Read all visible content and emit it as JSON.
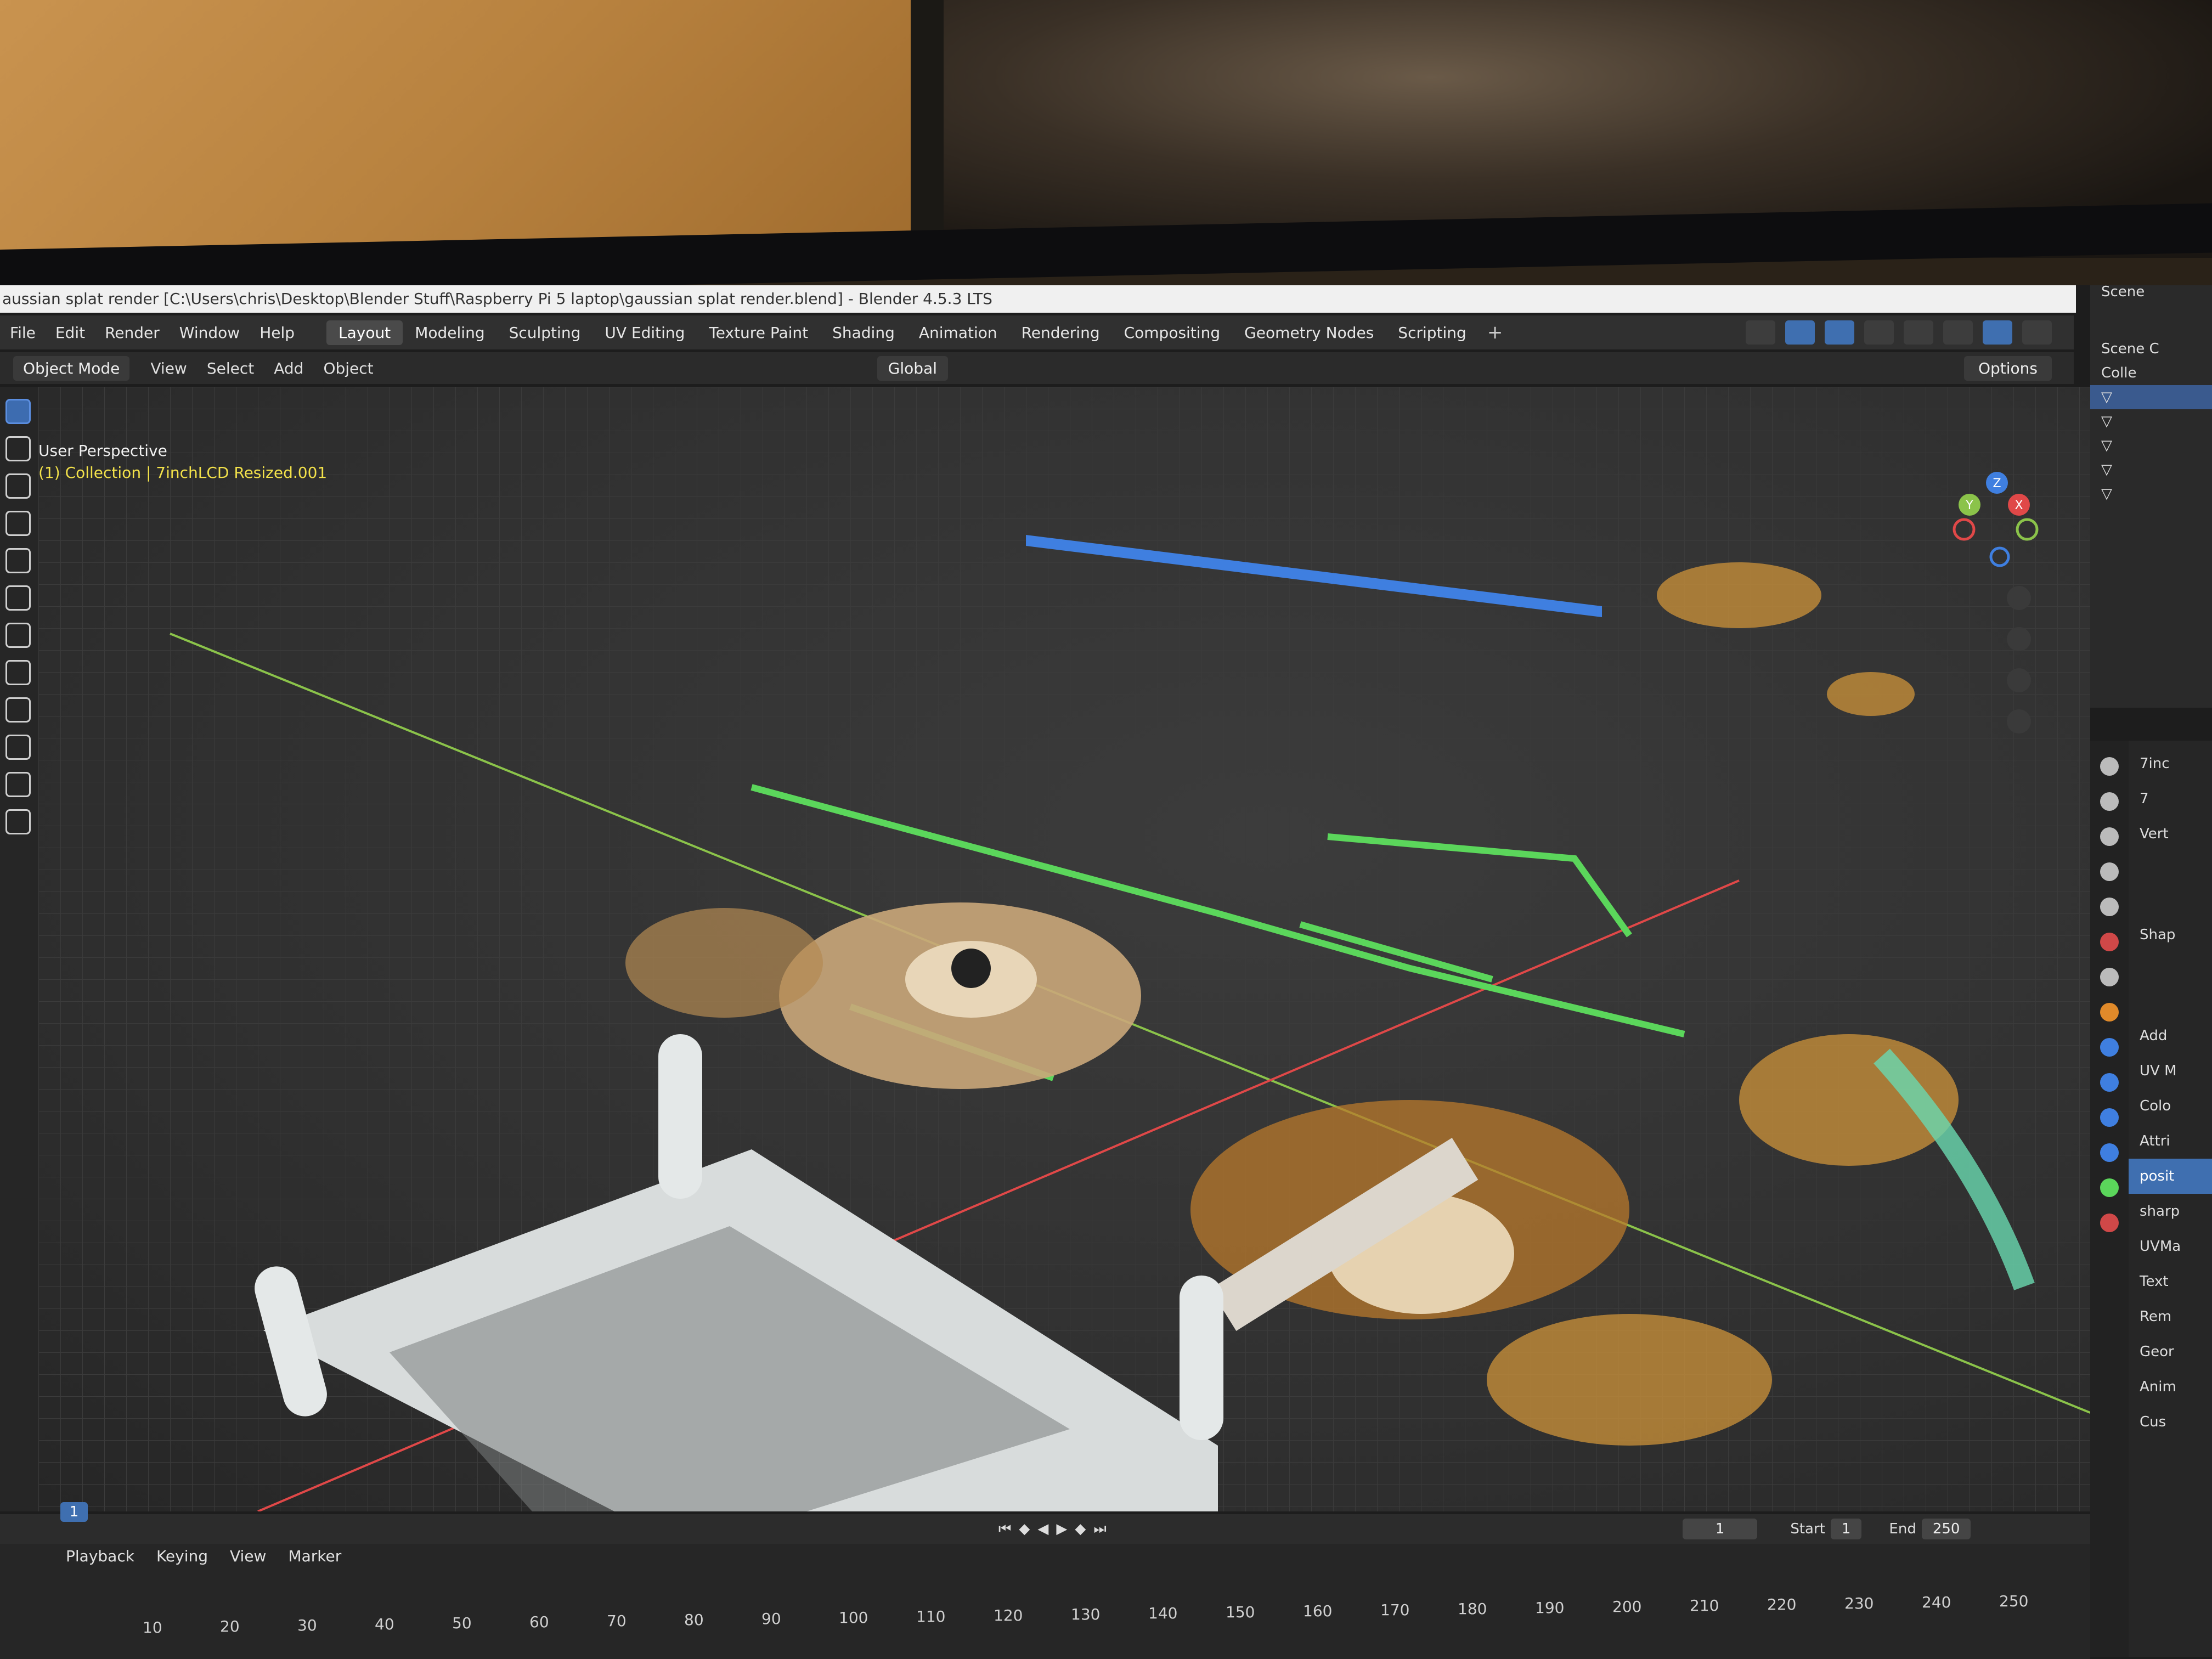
{
  "window": {
    "title": "aussian splat render [C:\\Users\\chris\\Desktop\\Blender Stuff\\Raspberry Pi 5 laptop\\gaussian splat render.blend] - Blender 4.5.3 LTS"
  },
  "menu": [
    "File",
    "Edit",
    "Render",
    "Window",
    "Help"
  ],
  "workspaces": [
    {
      "label": "Layout",
      "active": true
    },
    {
      "label": "Modeling"
    },
    {
      "label": "Sculpting"
    },
    {
      "label": "UV Editing"
    },
    {
      "label": "Texture Paint"
    },
    {
      "label": "Shading"
    },
    {
      "label": "Animation"
    },
    {
      "label": "Rendering"
    },
    {
      "label": "Compositing"
    },
    {
      "label": "Geometry Nodes"
    },
    {
      "label": "Scripting"
    }
  ],
  "header": {
    "mode": "Object Mode",
    "view": "View",
    "select": "Select",
    "add": "Add",
    "object": "Object",
    "transform_orientation": "Global",
    "options": "Options"
  },
  "viewport": {
    "perspective": "User Perspective",
    "collection_info": "(1) Collection | 7inchLCD Resized.001"
  },
  "gizmo": {
    "x": "X",
    "y": "Y",
    "z": "Z"
  },
  "outliner": {
    "scene_label": "Scene",
    "rows": [
      "Scene C",
      "Colle"
    ]
  },
  "properties": {
    "rows": [
      "7inc",
      "7",
      "Vert",
      "Shap",
      "Add",
      "UV M",
      "Colo",
      "Attri",
      "posit",
      "sharp",
      "UVMa",
      "Text",
      "Rem",
      "Geor",
      "Anim",
      "Cus"
    ]
  },
  "timeline": {
    "menu": [
      "Playback",
      "Keying",
      "View",
      "Marker"
    ],
    "current_frame": "1",
    "current_frame_badge": "1",
    "start_label": "Start",
    "start": "1",
    "end_label": "End",
    "end": "250",
    "ticks": [
      "10",
      "20",
      "30",
      "40",
      "50",
      "60",
      "70",
      "80",
      "90",
      "100",
      "110",
      "120",
      "130",
      "140",
      "150",
      "160",
      "170",
      "180",
      "190",
      "200",
      "210",
      "220",
      "230",
      "240",
      "250"
    ]
  },
  "colors": {
    "accent": "#3f6fb0",
    "collection_text": "#f2e14a",
    "axis_x": "#e04848",
    "axis_y": "#8bc34a",
    "axis_z": "#3f7fe0"
  }
}
